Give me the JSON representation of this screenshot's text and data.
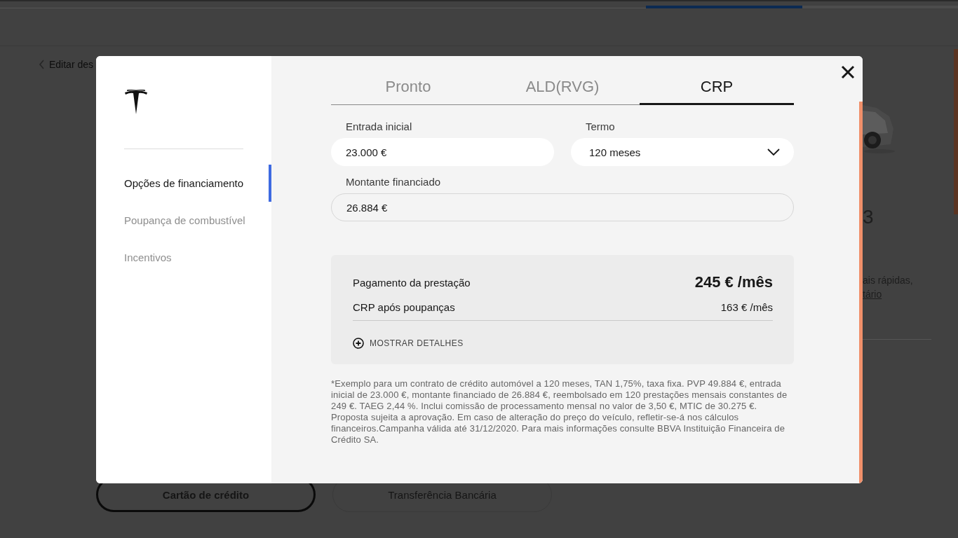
{
  "page": {
    "progress": {
      "level": 0.5
    },
    "back_link": "Editar des",
    "payment_buttons": [
      {
        "label": "Cartão de crédito",
        "selected": true
      },
      {
        "label": "Transferência Bancária",
        "selected": false
      }
    ],
    "side": {
      "heading": "3",
      "text": "ais rápidas,",
      "link": "tário"
    }
  },
  "modal": {
    "sidebar": {
      "items": [
        {
          "label": "Opções de financiamento",
          "selected": true
        },
        {
          "label": "Poupança de combustível",
          "selected": false
        },
        {
          "label": "Incentivos",
          "selected": false
        }
      ]
    },
    "tabs": [
      {
        "label": "Pronto",
        "selected": false
      },
      {
        "label": "ALD(RVG)",
        "selected": false
      },
      {
        "label": "CRP",
        "selected": true
      }
    ],
    "fields": [
      {
        "label": "Entrada inicial",
        "value": "23.000 €",
        "kind": "input"
      },
      {
        "label": "Termo",
        "value": "120 meses",
        "kind": "select"
      },
      {
        "label": "Montante financiado",
        "value": "26.884 €",
        "kind": "readonly"
      }
    ],
    "summary": {
      "main_label": "Pagamento da prestação",
      "main_value": "245 € /mês",
      "sub_label": "CRP após poupanças",
      "sub_value": "163 € /mês",
      "details_button": "MOSTRAR DETALHES"
    },
    "footnote": "*Exemplo para um contrato de crédito automóvel a 120 meses, TAN 1,75%, taxa fixa. PVP 49.884 €, entrada inicial de 23.000 €, montante financiado de 26.884 €, reembolsado em 120 prestações mensais constantes de 249 €. TAEG 2,44 %. Inclui comissão de processamento mensal no valor de 3,50 €, MTIC de 30.275 €. Proposta sujeita a aprovação. Em caso de alteração do preço do veículo, refletir-se-á nos cálculos financeiros.Campanha válida até 31/12/2020. Para mais informações consulte BBVA Instituição Financeira de Crédito SA."
  }
}
